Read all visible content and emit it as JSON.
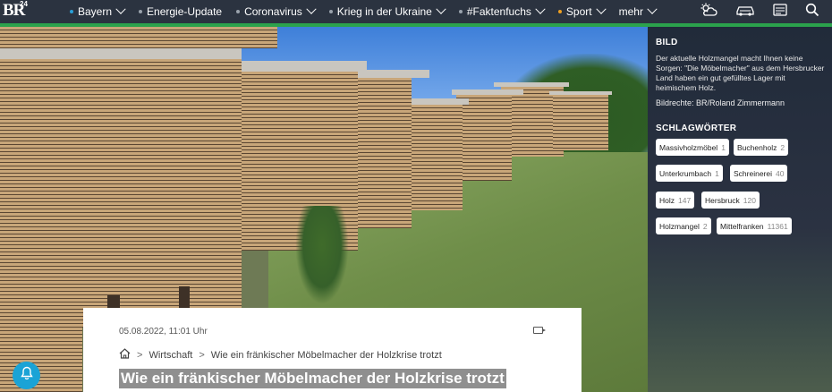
{
  "header": {
    "logo_text": "BR",
    "logo_sup": "24",
    "nav": [
      {
        "label": "Bayern",
        "dot_color": "#29a0d8",
        "has_chevron": true
      },
      {
        "label": "Energie-Update",
        "dot_color": "#9aa3ad",
        "has_chevron": false
      },
      {
        "label": "Coronavirus",
        "dot_color": "#9aa3ad",
        "has_chevron": true
      },
      {
        "label": "Krieg in der Ukraine",
        "dot_color": "#9aa3ad",
        "has_chevron": true
      },
      {
        "label": "#Faktenfuchs",
        "dot_color": "#9aa3ad",
        "has_chevron": true
      },
      {
        "label": "Sport",
        "dot_color": "#f0a020",
        "has_chevron": true
      },
      {
        "label": "mehr",
        "dot_color": null,
        "has_chevron": true
      }
    ],
    "icons": [
      "weather-icon",
      "traffic-icon",
      "teletext-icon",
      "search-icon"
    ],
    "accent_color": "#2ba24c"
  },
  "article": {
    "date": "05.08.2022, 11:01 Uhr",
    "breadcrumb": {
      "section": "Wirtschaft",
      "current": "Wie ein fränkischer Möbelmacher der Holzkrise trotzt"
    },
    "headline": "Wie ein fränkischer Möbelmacher der Holzkrise trotzt"
  },
  "sidebar": {
    "image_heading": "BILD",
    "caption": "Der aktuelle Holzmangel macht Ihnen keine Sorgen: \"Die Möbelmacher\" aus dem Hersbrucker Land haben ein gut gefülltes Lager mit heimischem Holz.",
    "credit": "Bildrechte: BR/Roland Zimmermann",
    "tags_heading": "SCHLAGWÖRTER",
    "tags": [
      {
        "label": "Massivholzmöbel",
        "count": "1"
      },
      {
        "label": "Buchenholz",
        "count": "2"
      },
      {
        "label": "Unterkrumbach",
        "count": "1"
      },
      {
        "label": "Schreinerei",
        "count": "40"
      },
      {
        "label": "Holz",
        "count": "147"
      },
      {
        "label": "Hersbruck",
        "count": "120"
      },
      {
        "label": "Holzmangel",
        "count": "2"
      },
      {
        "label": "Mittelfranken",
        "count": "11361"
      }
    ]
  }
}
